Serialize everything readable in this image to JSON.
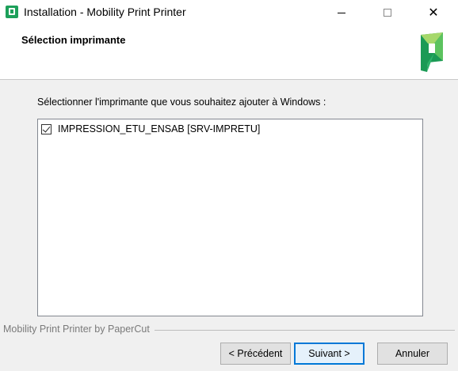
{
  "window": {
    "title": "Installation - Mobility Print Printer",
    "minimize_icon": "minimize-icon",
    "maximize_icon": "maximize-icon",
    "close_icon": "close-icon",
    "close_glyph": "✕"
  },
  "header": {
    "title": "Sélection imprimante",
    "logo": "papercut-logo",
    "logo_colors": [
      "#1b9a55",
      "#5cc35f",
      "#a6d86b"
    ]
  },
  "main": {
    "prompt": "Sélectionner l'imprimante que vous souhaitez ajouter à Windows :",
    "printers": [
      {
        "label": "IMPRESSION_ETU_ENSAB [SRV-IMPRETU]",
        "checked": true
      }
    ]
  },
  "footer": {
    "branding": "Mobility Print Printer by PaperCut",
    "buttons": {
      "back": "< Précédent",
      "next": "Suivant >",
      "cancel": "Annuler"
    }
  },
  "colors": {
    "accent": "#0078d7",
    "app_icon": "#1da05a"
  }
}
